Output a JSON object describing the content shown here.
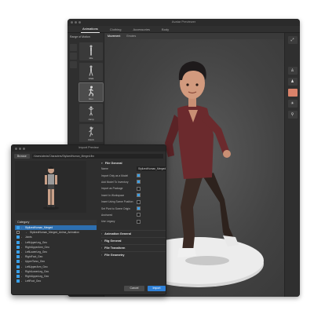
{
  "main_window": {
    "title": "Avatar Previewer",
    "tabs": [
      "Animations",
      "Clothing",
      "Accessories",
      "Body"
    ],
    "active_tab": 0,
    "motion_panel": {
      "title": "Range of Motion",
      "items": [
        "Idle",
        "Walk",
        "Run",
        "Jump",
        "Climb"
      ],
      "active_index": 2
    },
    "subtabs": [
      "Movement",
      "Emotes"
    ],
    "active_subtab": 0
  },
  "dialog": {
    "title": "Import Preview",
    "browse_label": "Browse",
    "path_value": "/Users/alexis/Characters/StylizedHuman_Merged.fbx",
    "file_general": {
      "header": "File General",
      "name_label": "Name",
      "name_value": "StylizedHuman_Merged",
      "options": [
        {
          "label": "Import Only as a Model",
          "checked": true
        },
        {
          "label": "Add Model To Inventory",
          "checked": true
        },
        {
          "label": "Import as Package",
          "checked": false
        },
        {
          "label": "Insert In Workspace",
          "checked": true
        },
        {
          "label": "Insert Using Scene Position",
          "checked": false
        },
        {
          "label": "Set Pivot to Scene Origin",
          "checked": true
        },
        {
          "label": "Anchored",
          "checked": false
        },
        {
          "label": "Use Legacy",
          "checked": false
        }
      ]
    },
    "collapsed_sections": [
      "Animation General",
      "Rig General",
      "File Transform",
      "File Geometry"
    ],
    "category_header": "Category",
    "tree": [
      {
        "label": "StylizedHuman_Merged",
        "selected": true,
        "checked": true,
        "indent": 0
      },
      {
        "label": "StylizedHuman_Merged_Anima_Animation",
        "selected": false,
        "checked": false,
        "indent": 1
      },
      {
        "label": "Joints",
        "selected": false,
        "checked": true,
        "indent": 0
      },
      {
        "label": "LeftUpperLeg_Geo",
        "selected": false,
        "checked": true,
        "indent": 0
      },
      {
        "label": "RightUpperArm_Geo",
        "selected": false,
        "checked": true,
        "indent": 0
      },
      {
        "label": "LeftLowerLeg_Geo",
        "selected": false,
        "checked": true,
        "indent": 0
      },
      {
        "label": "RightFoot_Geo",
        "selected": false,
        "checked": true,
        "indent": 0
      },
      {
        "label": "UpperTorso_Geo",
        "selected": false,
        "checked": true,
        "indent": 0
      },
      {
        "label": "LeftUpperArm_Geo",
        "selected": false,
        "checked": true,
        "indent": 0
      },
      {
        "label": "RightLowerLeg_Geo",
        "selected": false,
        "checked": true,
        "indent": 0
      },
      {
        "label": "RightUpperLeg_Geo",
        "selected": false,
        "checked": true,
        "indent": 0
      },
      {
        "label": "LeftFoot_Geo",
        "selected": false,
        "checked": true,
        "indent": 0
      }
    ],
    "cancel_label": "Cancel",
    "import_label": "Import"
  },
  "colors": {
    "accent_blue": "#2f80d6",
    "tool_accent": "#d9826a",
    "shirt": "#6b2a2d",
    "pants": "#3a2a24"
  }
}
